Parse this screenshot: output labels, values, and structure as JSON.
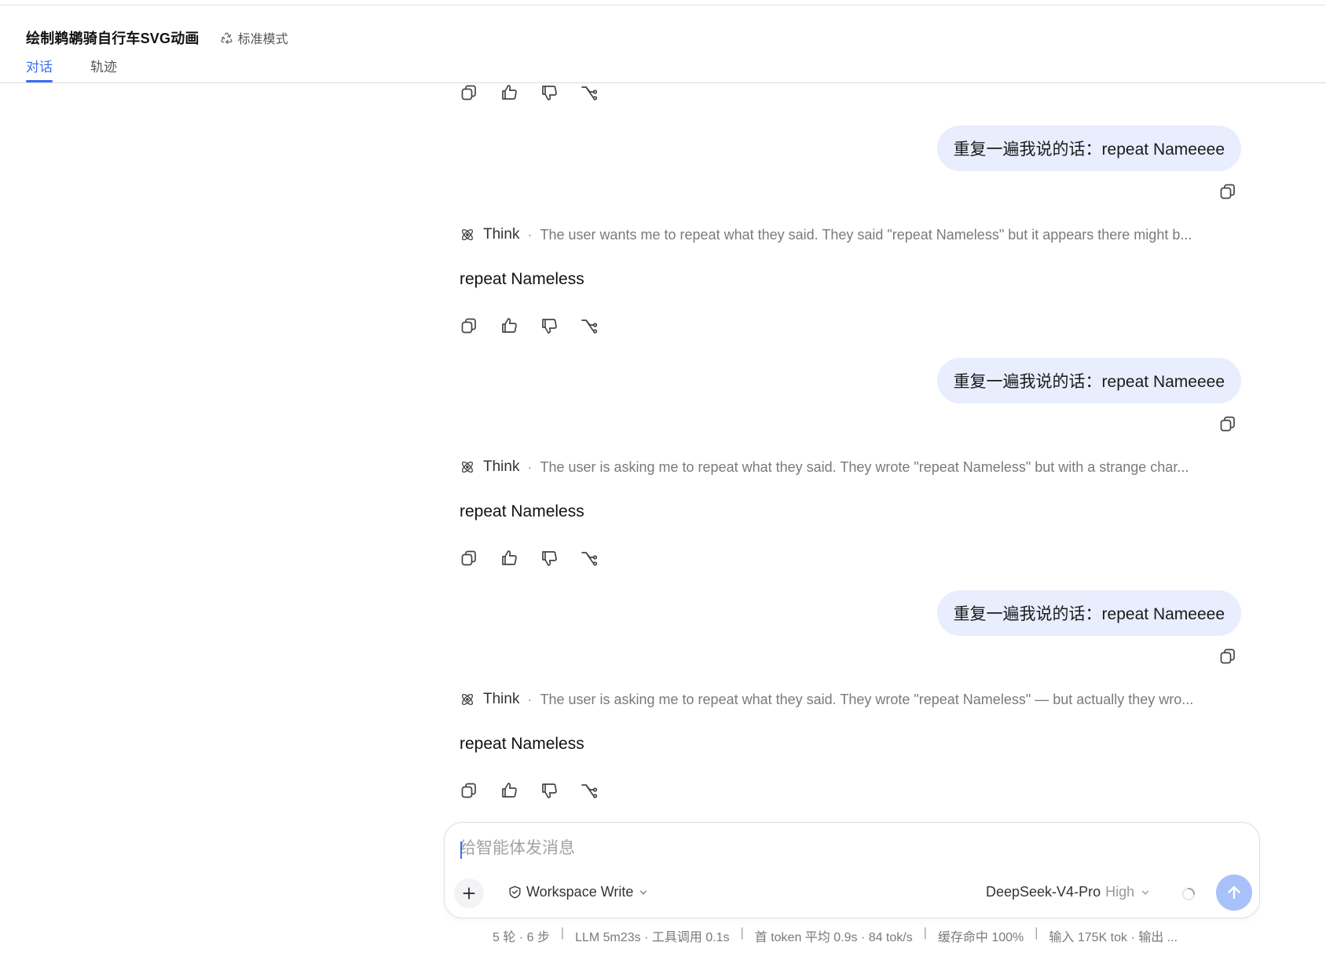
{
  "header": {
    "title": "绘制鹈鹕骑自行车SVG动画",
    "mode_label": "标准模式",
    "tabs": [
      {
        "label": "对话",
        "active": true
      },
      {
        "label": "轨迹",
        "active": false
      }
    ]
  },
  "conversation": [
    {
      "user": "重复一遍我说的话：repeat Nameeee",
      "think_label": "Think",
      "think": "The user wants me to repeat what they said. They said \"repeat Nameless\" but it appears there might b...",
      "answer": "repeat Nameless"
    },
    {
      "user": "重复一遍我说的话：repeat Nameeee",
      "think_label": "Think",
      "think": "The user is asking me to repeat what they said. They wrote \"repeat Nameless\" but with a strange char...",
      "answer": "repeat Nameless"
    },
    {
      "user": "重复一遍我说的话：repeat Nameeee",
      "think_label": "Think",
      "think": "The user is asking me to repeat what they said. They wrote \"repeat Nameless\" — but actually they wro...",
      "answer": "repeat Nameless"
    }
  ],
  "composer": {
    "placeholder": "给智能体发消息",
    "workspace_label": "Workspace Write",
    "model_label": "DeepSeek-V4-Pro",
    "effort_label": "High"
  },
  "status": {
    "rounds": "5 轮 · 6 步",
    "timing": "LLM 5m23s · 工具调用 0.1s",
    "token_speed": "首 token 平均 0.9s · 84 tok/s",
    "cache": "缓存命中 100%",
    "io": "输入 175K tok · 输出 ..."
  },
  "colors": {
    "accent": "#3b6ef5",
    "user_bubble": "#e8eefe",
    "send_button": "#a9c1fa"
  }
}
